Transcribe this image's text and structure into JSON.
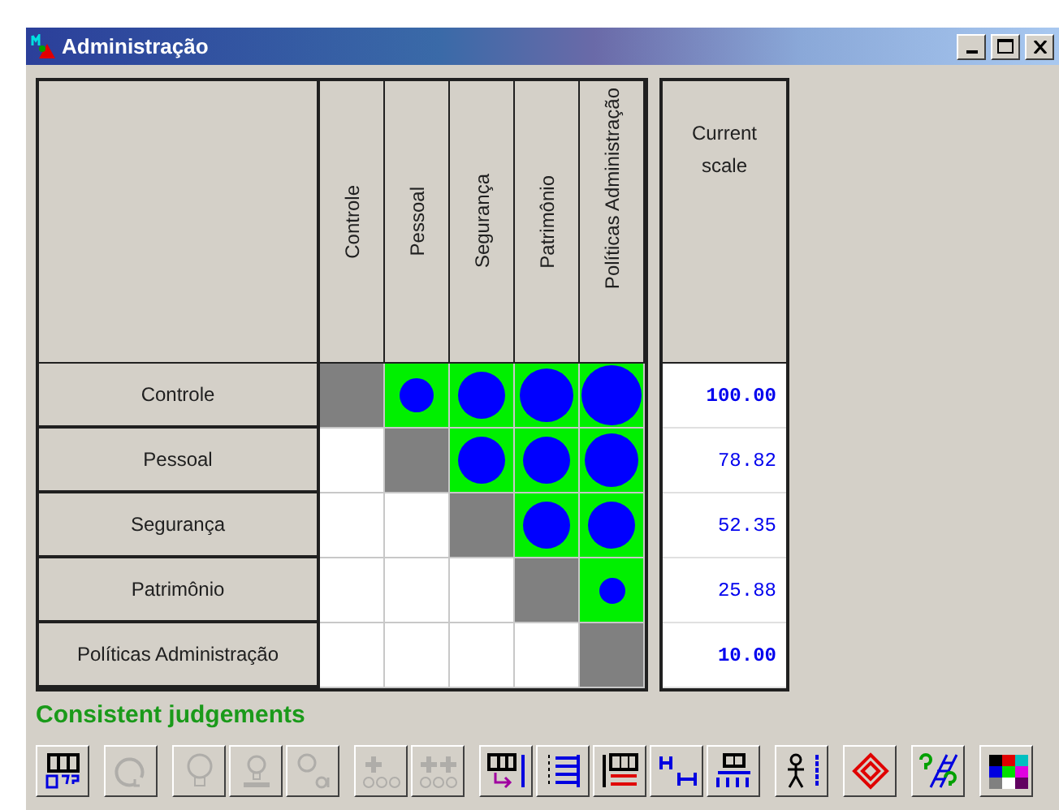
{
  "window": {
    "title": "Administração"
  },
  "matrix": {
    "columns": [
      "Controle",
      "Pessoal",
      "Segurança",
      "Patrimônio",
      "Políticas Administração"
    ],
    "scale_header": "Current scale",
    "rows": [
      {
        "label": "Controle",
        "scale": "100.00",
        "emphasized": true,
        "cells": [
          {
            "kind": "diagonal"
          },
          {
            "kind": "dot-small"
          },
          {
            "kind": "dot-medium"
          },
          {
            "kind": "dot-large"
          },
          {
            "kind": "dot-largest"
          }
        ]
      },
      {
        "label": "Pessoal",
        "scale": "78.82",
        "emphasized": false,
        "cells": [
          {
            "kind": "empty"
          },
          {
            "kind": "diagonal"
          },
          {
            "kind": "dot-medium"
          },
          {
            "kind": "dot-medium"
          },
          {
            "kind": "dot-large"
          }
        ]
      },
      {
        "label": "Segurança",
        "scale": "52.35",
        "emphasized": false,
        "cells": [
          {
            "kind": "empty"
          },
          {
            "kind": "empty"
          },
          {
            "kind": "diagonal"
          },
          {
            "kind": "dot-medium"
          },
          {
            "kind": "dot-medium"
          }
        ]
      },
      {
        "label": "Patrimônio",
        "scale": "25.88",
        "emphasized": false,
        "cells": [
          {
            "kind": "empty"
          },
          {
            "kind": "empty"
          },
          {
            "kind": "empty"
          },
          {
            "kind": "diagonal"
          },
          {
            "kind": "dot-tiny"
          }
        ]
      },
      {
        "label": "Políticas Administração",
        "scale": "10.00",
        "emphasized": true,
        "cells": [
          {
            "kind": "empty"
          },
          {
            "kind": "empty"
          },
          {
            "kind": "empty"
          },
          {
            "kind": "empty"
          },
          {
            "kind": "diagonal"
          }
        ]
      }
    ]
  },
  "status": "Consistent judgements",
  "toolbar": [
    {
      "buttons": [
        {
          "kind": "grid-check",
          "disabled": false
        }
      ]
    },
    {
      "buttons": [
        {
          "kind": "cycle",
          "disabled": true
        }
      ]
    },
    {
      "buttons": [
        {
          "kind": "bulb",
          "disabled": true
        },
        {
          "kind": "bulb-base",
          "disabled": true
        },
        {
          "kind": "bulb-ok",
          "disabled": true
        }
      ]
    },
    {
      "buttons": [
        {
          "kind": "plus-bulbs",
          "disabled": true
        },
        {
          "kind": "plus-plus",
          "disabled": true
        }
      ]
    },
    {
      "buttons": [
        {
          "kind": "grid-arrow",
          "disabled": false
        },
        {
          "kind": "list",
          "disabled": false
        },
        {
          "kind": "grid-ruler",
          "disabled": false
        },
        {
          "kind": "h-span",
          "disabled": false
        },
        {
          "kind": "diff",
          "disabled": false
        }
      ]
    },
    {
      "buttons": [
        {
          "kind": "stick-figure",
          "disabled": false
        }
      ]
    },
    {
      "buttons": [
        {
          "kind": "diamond",
          "disabled": false
        }
      ]
    },
    {
      "buttons": [
        {
          "kind": "question-ladder",
          "disabled": false
        }
      ]
    },
    {
      "buttons": [
        {
          "kind": "palette",
          "disabled": false
        }
      ]
    }
  ]
}
